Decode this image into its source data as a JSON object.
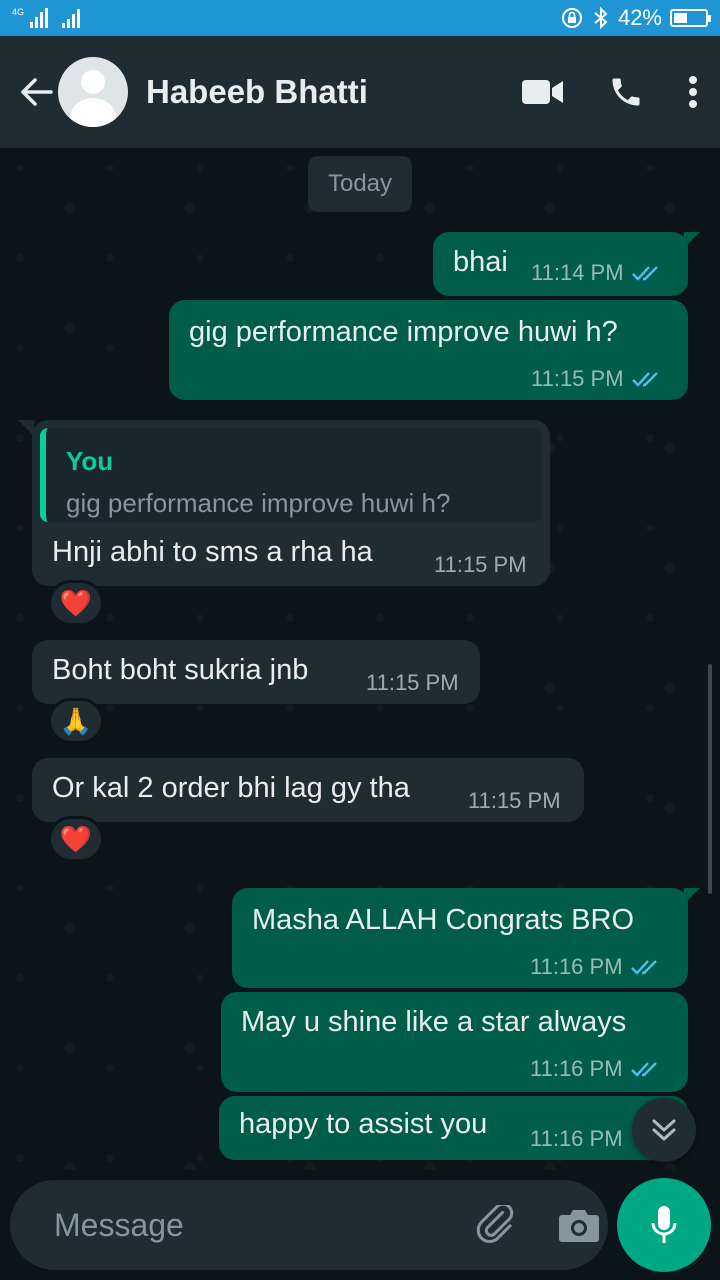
{
  "status_bar": {
    "network": "4G",
    "battery_percent": "42%",
    "battery_level": 0.42
  },
  "header": {
    "contact_name": "Habeeb Bhatti"
  },
  "chat": {
    "date_label": "Today",
    "messages": [
      {
        "direction": "out",
        "text": "bhai",
        "time": "11:14 PM",
        "status": "read"
      },
      {
        "direction": "out",
        "text": "gig performance improve huwi h?",
        "time": "11:15 PM",
        "status": "read"
      },
      {
        "direction": "in",
        "quote_author": "You",
        "quote_text": "gig performance improve huwi h?",
        "text": "Hnji abhi to sms a rha ha",
        "time": "11:15 PM",
        "reaction": "❤️"
      },
      {
        "direction": "in",
        "text": "Boht boht sukria jnb",
        "time": "11:15 PM",
        "reaction": "🙏"
      },
      {
        "direction": "in",
        "text": "Or kal 2 order bhi lag gy tha",
        "time": "11:15 PM",
        "reaction": "❤️"
      },
      {
        "direction": "out",
        "text": "Masha ALLAH Congrats BRO",
        "time": "11:16 PM",
        "status": "read"
      },
      {
        "direction": "out",
        "text": "May u shine like a star always",
        "time": "11:16 PM",
        "status": "read"
      },
      {
        "direction": "out",
        "text": "happy to assist you",
        "time": "11:16 PM",
        "status": "read"
      }
    ]
  },
  "composer": {
    "placeholder": "Message"
  },
  "colors": {
    "accent": "#00a884",
    "outgoing_bubble": "#005c4b",
    "incoming_bubble": "#1f2c34",
    "read_ticks": "#53bdeb"
  }
}
